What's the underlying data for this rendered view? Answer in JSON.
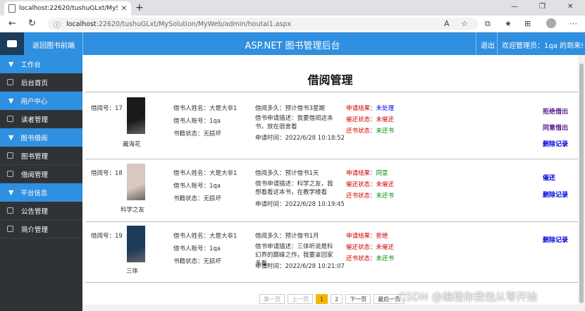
{
  "browser": {
    "tab_title": "localhost:22620/tushuGLxt/MySo",
    "url_host": "localhost",
    "url_rest": ":22620/tushuGLxt/MySolution/MyWeb/admin/houtai1.aspx"
  },
  "topbar": {
    "back_label": "返回图书前端",
    "title": "ASP.NET 图书管理后台",
    "exit_label": "退出",
    "welcome": "欢迎管理员：1qa 的到来!"
  },
  "sidebar": {
    "groups": [
      {
        "label": "工作台",
        "items": [
          {
            "label": "后台首页"
          }
        ]
      },
      {
        "label": "用户中心",
        "items": [
          {
            "label": "读者管理"
          }
        ]
      },
      {
        "label": "图书借阅",
        "items": [
          {
            "label": "图书管理"
          },
          {
            "label": "借阅管理"
          }
        ]
      },
      {
        "label": "平台信息",
        "items": [
          {
            "label": "公告管理"
          },
          {
            "label": "简介管理"
          }
        ]
      }
    ]
  },
  "page": {
    "title": "借阅管理"
  },
  "records": [
    {
      "borrow_no": "借阅号：17",
      "book_name": "藏海花",
      "user_name": "借书人姓名：大是大非1",
      "user_account": "借书人账号：1qa",
      "book_state": "书籍状态：无损坏",
      "duration": "借阅多久：预计借书3星期",
      "desc": "借书申请描述：我要借阅这本书，放在宿舍看",
      "apply_time": "申请时间：2022/6/28 10:18:52",
      "result_label": "申请结果：",
      "result_value": "未处理",
      "result_color": "#0000ff",
      "overdue_label": "催还状态：",
      "overdue_value": "未催还",
      "return_label": "还书状态：",
      "return_value": "未还书",
      "actions": [
        "拒绝借出",
        "同意借出",
        "删除记录"
      ],
      "cover_color": "#1a1a1a"
    },
    {
      "borrow_no": "借阅号：18",
      "book_name": "科学之友",
      "user_name": "借书人姓名：大是大非1",
      "user_account": "借书人账号：1qa",
      "book_state": "书籍状态：无损坏",
      "duration": "借阅多久：预计借书1天",
      "desc": "借书申请描述：科学之友，我想看看这本书，在教学楼看",
      "apply_time": "申请时间：2022/6/28 10:19:45",
      "result_label": "申请结果：",
      "result_value": "同意",
      "result_color": "#008800",
      "overdue_label": "催还状态：",
      "overdue_value": "未催还",
      "return_label": "还书状态：",
      "return_value": "未还书",
      "actions": [
        "催还",
        "删除记录"
      ],
      "cover_color": "#d8c8c0"
    },
    {
      "borrow_no": "借阅号：19",
      "book_name": "三体",
      "user_name": "借书人姓名：大是大非1",
      "user_account": "借书人账号：1qa",
      "book_state": "书籍状态：无损坏",
      "duration": "借阅多久：预计借书1月",
      "desc": "借书申请描述：三体听说是科幻界的巅峰之作，我要拿回家多看。",
      "apply_time": "申请时间：2022/6/28 10:21:07",
      "result_label": "申请结果：",
      "result_value": "拒绝",
      "result_color": "#cc0000",
      "overdue_label": "催还状态：",
      "overdue_value": "未催还",
      "return_label": "还书状态：",
      "return_value": "未还书",
      "actions": [
        "删除记录"
      ],
      "cover_color": "#1c3a5a"
    }
  ],
  "pager": {
    "first": "第一页",
    "prev": "上一页",
    "pages": [
      "1",
      "2"
    ],
    "current": "1",
    "next": "下一页",
    "last": "最后一页"
  },
  "watermark": "CSDN @编程你我他从零开始"
}
